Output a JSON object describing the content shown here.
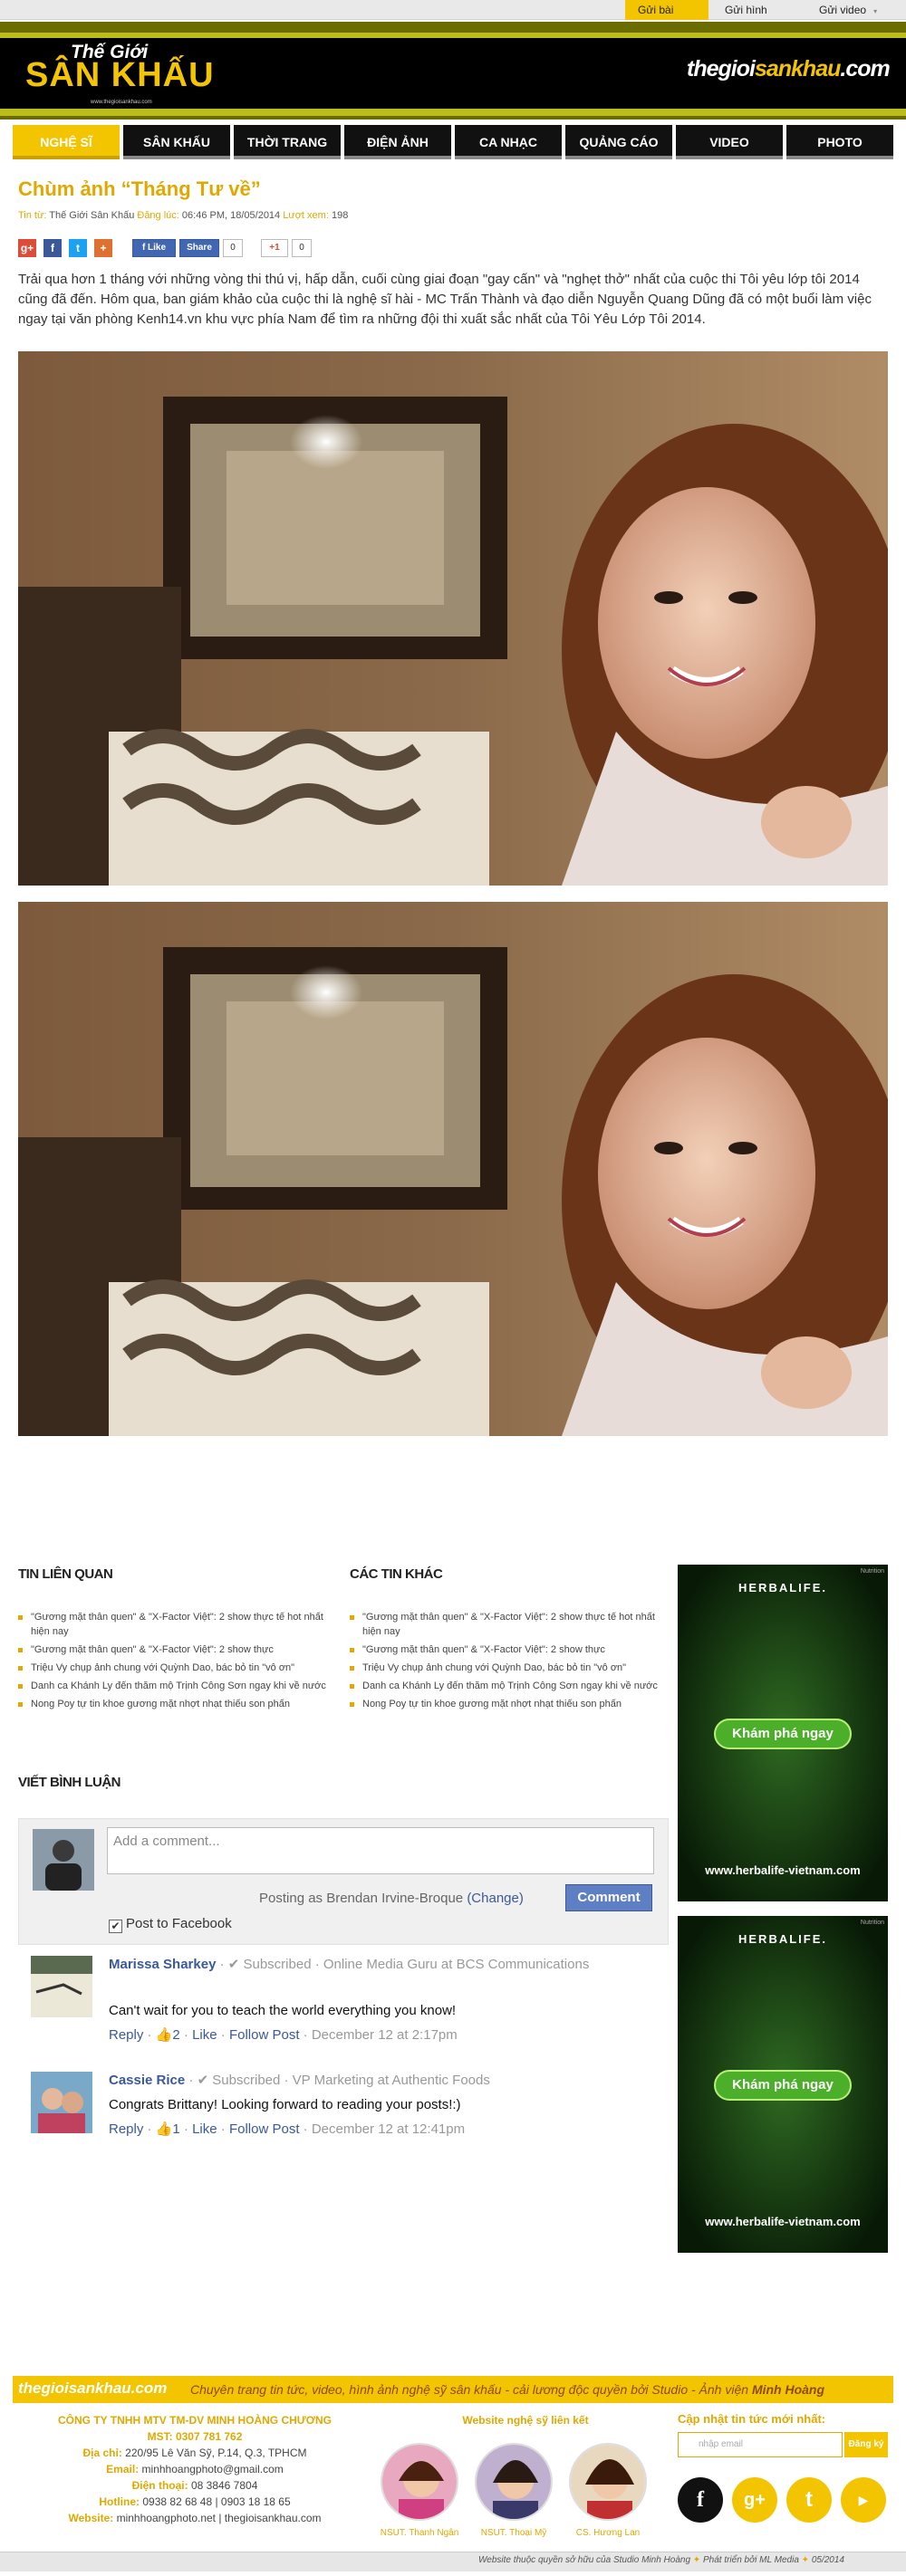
{
  "topbar": {
    "items": [
      {
        "label": "Gửi bài viết",
        "active": true
      },
      {
        "label": "Gửi hình ảnh",
        "active": false
      },
      {
        "label": "Gửi video",
        "active": false
      }
    ]
  },
  "header": {
    "logo_top": "Thế Giới",
    "logo_main": "SÂN KHẤU",
    "logo_url": "www.thegioisankhau.com",
    "site_name_a": "thegioi",
    "site_name_b": "sankhau",
    "site_name_c": ".com"
  },
  "nav": {
    "items": [
      "NGHỆ SĨ",
      "SÂN KHẤU",
      "THỜI TRANG",
      "ĐIỆN ẢNH",
      "CA NHẠC",
      "QUẢNG CÁO",
      "VIDEO",
      "PHOTO"
    ],
    "active_index": 0
  },
  "article": {
    "title": "Chùm ảnh “Tháng Tư về”",
    "source_label": "Tin từ:",
    "source": "Thế Giới Sân Khấu",
    "posted_label": "Đăng lúc:",
    "posted": "06:46 PM, 18/05/2014",
    "views_label": "Lượt xem:",
    "views": "198",
    "lead": "Trải qua hơn 1 tháng với những vòng thi thú vị, hấp dẫn, cuối cùng giai đoạn \"gay cấn\" và \"nghẹt thở\" nhất của cuộc thi Tôi yêu lớp tôi 2014 cũng đã đến. Hôm qua, ban giám khảo của cuộc thi là nghệ sĩ hài - MC Trấn Thành và đạo diễn Nguyễn Quang Dũng đã có một buổi làm việc ngay tại văn phòng Kenh14.vn khu vực phía Nam để tìm ra những đội thi xuất sắc nhất của Tôi Yêu Lớp Tôi 2014."
  },
  "share": {
    "like_label": "Like",
    "share_label": "Share",
    "like_count": "0",
    "gplus_label": "+1",
    "gplus_count": "0"
  },
  "related": {
    "heading": "TIN LIÊN QUAN",
    "items": [
      "\"Gương mặt thân quen\" & \"X-Factor Việt\": 2 show thực tế hot nhất hiện nay",
      "\"Gương mặt thân quen\" & \"X-Factor Việt\": 2 show thực",
      "Triệu Vy chụp ảnh chung với Quỳnh Dao, bác bỏ tin \"vô ơn\"",
      "Danh ca Khánh Ly đến thăm mộ Trịnh Công Sơn ngay khi về nước",
      "Nong Poy tự tin khoe gương mặt nhợt nhạt thiếu son phấn"
    ]
  },
  "other": {
    "heading": "CÁC TIN KHÁC",
    "items": [
      "\"Gương mặt thân quen\" & \"X-Factor Việt\": 2 show thực tế hot nhất hiện nay",
      "\"Gương mặt thân quen\" & \"X-Factor Việt\": 2 show thực",
      "Triệu Vy chụp ảnh chung với Quỳnh Dao, bác bỏ tin \"vô ơn\"",
      "Danh ca Khánh Ly đến thăm mộ Trịnh Công Sơn ngay khi về nước",
      "Nong Poy tự tin khoe gương mặt nhợt nhạt thiếu son phấn"
    ]
  },
  "comments": {
    "heading": "VIẾT BÌNH LUẬN",
    "placeholder": "Add a comment...",
    "posting_as": "Posting as Brendan Irvine-Broque",
    "change": "(Change)",
    "button": "Comment",
    "post_to_fb": "Post to Facebook",
    "list": [
      {
        "name": "Marissa Sharkey",
        "meta": " · ✔ Subscribed · Online Media Guru at BCS Communications",
        "text": "Can't wait for you to teach the world everything you know!",
        "reply": "Reply",
        "likes": "2",
        "like": "Like",
        "follow": "Follow Post",
        "date": "December 12 at 2:17pm"
      },
      {
        "name": "Cassie Rice",
        "meta": " · ✔ Subscribed · VP Marketing at Authentic Foods",
        "text": "Congrats Brittany! Looking forward to reading your posts!:)",
        "reply": "Reply",
        "likes": "1",
        "like": "Like",
        "follow": "Follow Post",
        "date": "December 12 at 12:41pm"
      }
    ]
  },
  "ads": [
    {
      "brand": "HERBALIFE.",
      "cta": "Khám phá ngay",
      "url": "www.herbalife-vietnam.com",
      "tag": "Nutrition"
    },
    {
      "brand": "HERBALIFE.",
      "cta": "Khám phá ngay",
      "url": "www.herbalife-vietnam.com",
      "tag": "Nutrition"
    }
  ],
  "footer": {
    "brand": "thegioisankhau.com",
    "slogan_a": "Chuyên trang tin tức, video, hình ảnh nghệ sỹ sân khấu - cải lương độc quyền bởi Studio - Ảnh viện ",
    "slogan_b": "Minh Hoàng",
    "company": "CÔNG TY TNHH MTV TM-DV MINH HOÀNG CHƯƠNG",
    "mst": "MST: 0307 781 762",
    "address_label": "Địa chỉ:",
    "address": "220/95 Lê Văn Sỹ, P.14, Q.3, TPHCM",
    "email_label": "Email:",
    "email": "minhhoangphoto@gmail.com",
    "phone_label": "Điện thoại:",
    "phone": "08 3846 7804",
    "hotline_label": "Hotline:",
    "hotline": "0938 82 68 48 | 0903 18 18 65",
    "website_label": "Website:",
    "website": "minhhoangphoto.net | thegioisankhau.com",
    "artists_heading": "Website nghệ sỹ liên kết",
    "artists": [
      "NSUT. Thanh Ngân",
      "NSUT. Thoại Mỹ",
      "CS. Hương Lan"
    ],
    "subscribe_heading": "Cập nhật tin tức mới nhất:",
    "subscribe_placeholder": "nhập email",
    "subscribe_button": "Đăng ký",
    "copyright": "Website thuộc quyền sở hữu của Studio Minh Hoàng",
    "developer": "Phát triển bởi ML Media",
    "date": "05/2014"
  },
  "colors": {
    "accent": "#f3c400",
    "text_accent": "#e0a800",
    "facebook": "#3b5998",
    "herbalife_green": "#4caf2a"
  }
}
